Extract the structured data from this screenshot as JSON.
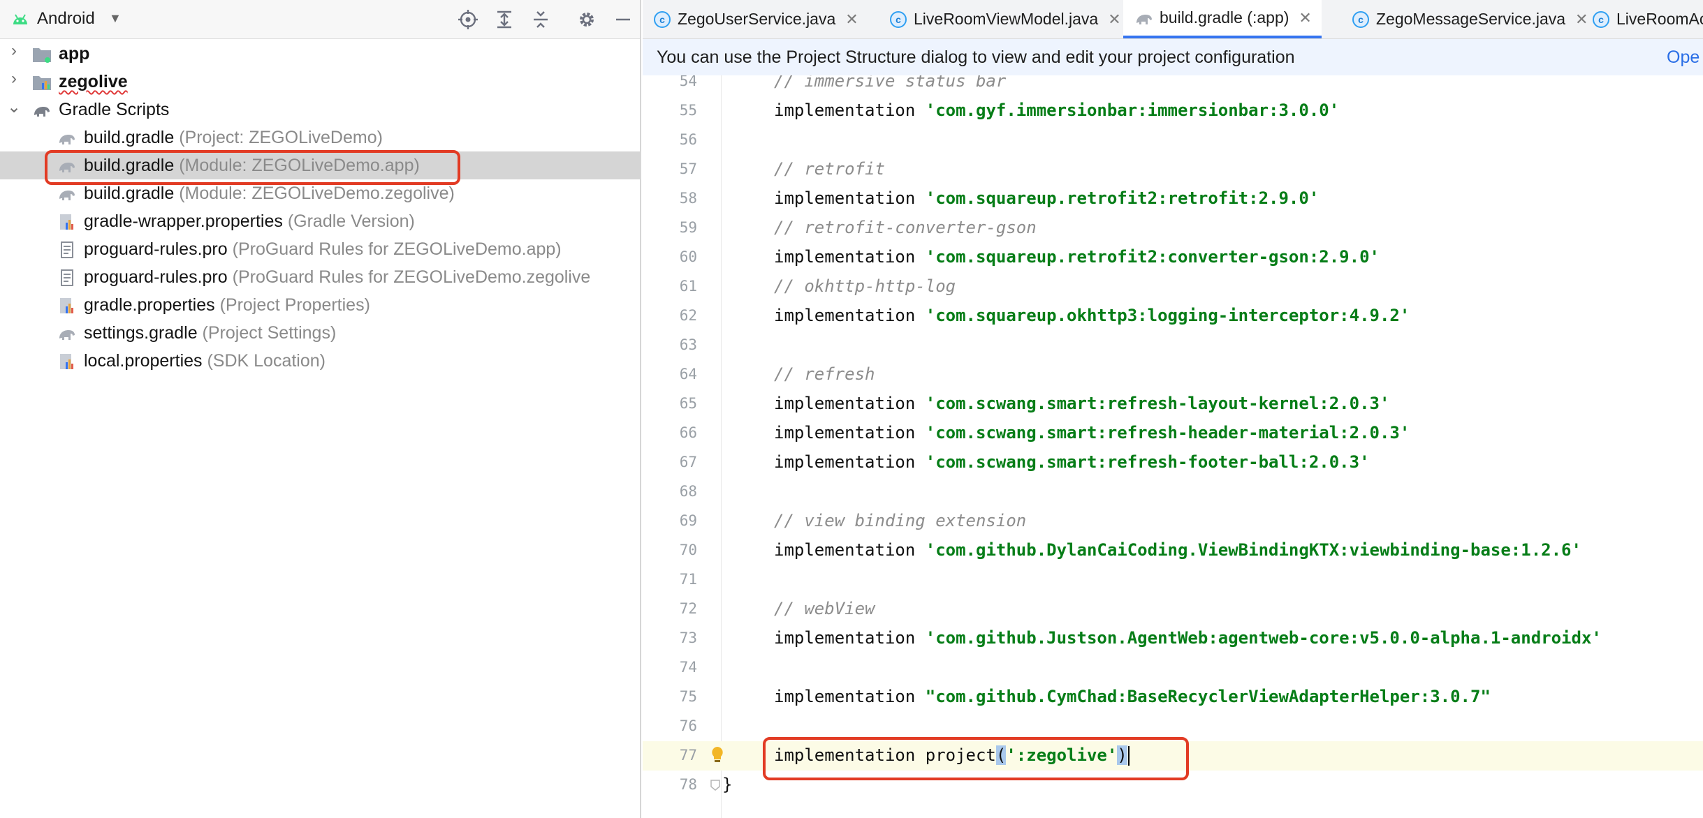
{
  "project_pane": {
    "view_label": "Android",
    "header_buttons": [
      "locate-icon",
      "expand-all-icon",
      "collapse-all-icon",
      "settings-icon",
      "hide-icon"
    ]
  },
  "tree": [
    {
      "name": "app",
      "note": "",
      "bold": true,
      "icon": "module-folder-icon",
      "chevron": "›",
      "indent": 0
    },
    {
      "name": "zegolive",
      "note": "",
      "bold": true,
      "icon": "library-module-icon",
      "chevron": "›",
      "indent": 0
    },
    {
      "name": "Gradle Scripts",
      "note": "",
      "bold": false,
      "icon": "gradle-elephant-icon",
      "chevron": "⌄",
      "indent": 0
    },
    {
      "name": "build.gradle",
      "note": "(Project: ZEGOLiveDemo)",
      "icon": "gradle-file-icon",
      "indent": 1
    },
    {
      "name": "build.gradle",
      "note": "(Module: ZEGOLiveDemo.app)",
      "icon": "gradle-file-icon",
      "indent": 1,
      "selected": true
    },
    {
      "name": "build.gradle",
      "note": "(Module: ZEGOLiveDemo.zegolive)",
      "icon": "gradle-file-icon",
      "indent": 1
    },
    {
      "name": "gradle-wrapper.properties",
      "note": "(Gradle Version)",
      "icon": "properties-file-icon",
      "indent": 1
    },
    {
      "name": "proguard-rules.pro",
      "note": "(ProGuard Rules for ZEGOLiveDemo.app)",
      "icon": "text-file-icon",
      "indent": 1
    },
    {
      "name": "proguard-rules.pro",
      "note": "(ProGuard Rules for ZEGOLiveDemo.zegolive",
      "icon": "text-file-icon",
      "indent": 1
    },
    {
      "name": "gradle.properties",
      "note": "(Project Properties)",
      "icon": "properties-file-icon",
      "indent": 1
    },
    {
      "name": "settings.gradle",
      "note": "(Project Settings)",
      "icon": "gradle-file-icon",
      "indent": 1
    },
    {
      "name": "local.properties",
      "note": "(SDK Location)",
      "icon": "properties-file-icon",
      "indent": 1
    }
  ],
  "tabs": [
    {
      "label": "ZegoUserService.java",
      "active": false,
      "icon": "java-class-icon"
    },
    {
      "label": "LiveRoomViewModel.java",
      "active": false,
      "icon": "java-class-icon"
    },
    {
      "label": "build.gradle (:app)",
      "active": true,
      "icon": "gradle-file-icon"
    },
    {
      "label": "ZegoMessageService.java",
      "active": false,
      "icon": "java-class-icon"
    },
    {
      "label": "LiveRoomAct",
      "active": false,
      "icon": "java-class-icon"
    }
  ],
  "banner": {
    "text": "You can use the Project Structure dialog to view and edit your project configuration",
    "link": "Ope"
  },
  "code_lines": [
    {
      "n": "54",
      "kind": "comment",
      "text": "// immersive status bar"
    },
    {
      "n": "55",
      "kind": "impl",
      "text": "implementation ",
      "str": "'com.gyf.immersionbar:immersionbar:3.0.0'"
    },
    {
      "n": "56",
      "kind": "blank",
      "text": ""
    },
    {
      "n": "57",
      "kind": "comment",
      "text": "// retrofit"
    },
    {
      "n": "58",
      "kind": "impl",
      "text": "implementation ",
      "str": "'com.squareup.retrofit2:retrofit:2.9.0'"
    },
    {
      "n": "59",
      "kind": "comment",
      "text": "// retrofit-converter-gson"
    },
    {
      "n": "60",
      "kind": "impl",
      "text": "implementation ",
      "str": "'com.squareup.retrofit2:converter-gson:2.9.0'"
    },
    {
      "n": "61",
      "kind": "comment",
      "text": "// okhttp-http-log"
    },
    {
      "n": "62",
      "kind": "impl",
      "text": "implementation ",
      "str": "'com.squareup.okhttp3:logging-interceptor:4.9.2'"
    },
    {
      "n": "63",
      "kind": "blank",
      "text": ""
    },
    {
      "n": "64",
      "kind": "comment",
      "text": "// refresh"
    },
    {
      "n": "65",
      "kind": "impl",
      "text": "implementation ",
      "str": "'com.scwang.smart:refresh-layout-kernel:2.0.3'"
    },
    {
      "n": "66",
      "kind": "impl",
      "text": "implementation ",
      "str": "'com.scwang.smart:refresh-header-material:2.0.3'"
    },
    {
      "n": "67",
      "kind": "impl",
      "text": "implementation ",
      "str": "'com.scwang.smart:refresh-footer-ball:2.0.3'"
    },
    {
      "n": "68",
      "kind": "blank",
      "text": ""
    },
    {
      "n": "69",
      "kind": "comment",
      "text": "// view binding extension"
    },
    {
      "n": "70",
      "kind": "impl",
      "text": "implementation ",
      "str": "'com.github.DylanCaiCoding.ViewBindingKTX:viewbinding-base:1.2.6'"
    },
    {
      "n": "71",
      "kind": "blank",
      "text": ""
    },
    {
      "n": "72",
      "kind": "comment",
      "text": "// webView"
    },
    {
      "n": "73",
      "kind": "impl",
      "text": "implementation ",
      "str": "'com.github.Justson.AgentWeb:agentweb-core:v5.0.0-alpha.1-androidx'"
    },
    {
      "n": "74",
      "kind": "blank",
      "text": ""
    },
    {
      "n": "75",
      "kind": "impl",
      "text": "implementation ",
      "str": "\"com.github.CymChad:BaseRecyclerViewAdapterHelper:3.0.7\""
    },
    {
      "n": "76",
      "kind": "blank",
      "text": ""
    },
    {
      "n": "77",
      "kind": "project",
      "text": "implementation project",
      "open": "(",
      "str": "':zegolive'",
      "close": ")"
    },
    {
      "n": "78",
      "kind": "plain",
      "text": "}"
    }
  ],
  "colors": {
    "highlight_box": "#e23b24",
    "string": "#067d17",
    "comment": "#8c8c8c",
    "active_tab_underline": "#3574f0"
  }
}
